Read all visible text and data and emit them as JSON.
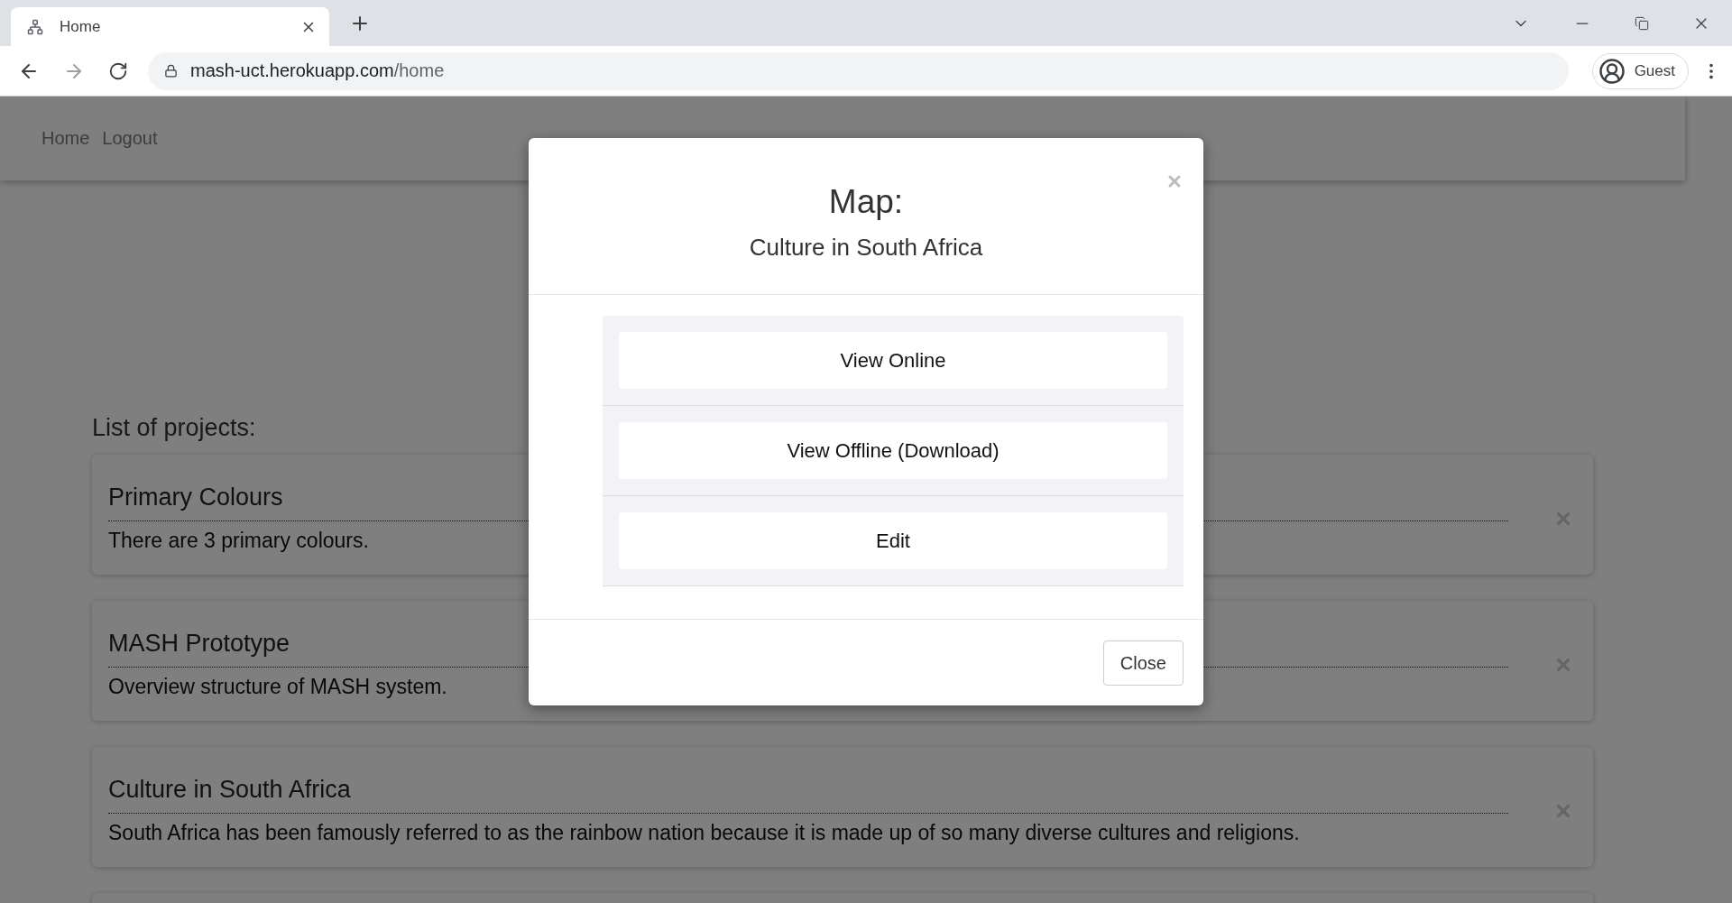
{
  "browser": {
    "tab_title": "Home",
    "url_host": "mash-uct.herokuapp.com",
    "url_path": "/home",
    "profile": "Guest"
  },
  "navbar": {
    "links": [
      "Home",
      "Logout"
    ]
  },
  "projects": {
    "heading": "List of projects:",
    "items": [
      {
        "title": "Primary Colours",
        "description": "There are 3 primary colours."
      },
      {
        "title": "MASH Prototype",
        "description": "Overview structure of MASH system."
      },
      {
        "title": "Culture in South Africa",
        "description": "South Africa has been famously referred to as the rainbow nation because it is made up of so many diverse cultures and religions."
      }
    ]
  },
  "modal": {
    "title": "Map:",
    "subtitle": "Culture in South Africa",
    "actions": [
      "View Online",
      "View Offline (Download)",
      "Edit"
    ],
    "footer_button": "Close"
  }
}
